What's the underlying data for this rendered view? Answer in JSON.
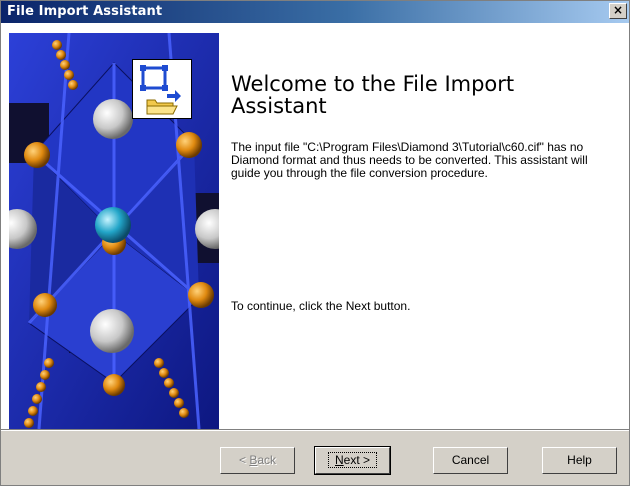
{
  "window": {
    "title": "File Import Assistant",
    "close_symbol": "×"
  },
  "main": {
    "heading": "Welcome to the File Import Assistant",
    "description": "The input file \"C:\\Program Files\\Diamond 3\\Tutorial\\c60.cif\" has no Diamond format and thus needs to be converted. This assistant will guide you through the file conversion procedure.",
    "continue_text": "To continue, click the Next button."
  },
  "buttons": {
    "back": {
      "arrow": "< ",
      "mnemonic": "B",
      "rest": "ack"
    },
    "next": {
      "mnemonic": "N",
      "rest": "ext",
      "arrow": " >"
    },
    "cancel": "Cancel",
    "help": "Help"
  },
  "icons": {
    "sidebar": "crystal-structure-illustration",
    "app": "file-import-icon"
  },
  "colors": {
    "title_start": "#0a246a",
    "title_end": "#a6caf0",
    "sidebar_blue": "#1b2aa8",
    "atom_orange": "#e08a10",
    "atom_cyan": "#22a5c8",
    "atom_gray": "#c8c8c8"
  }
}
